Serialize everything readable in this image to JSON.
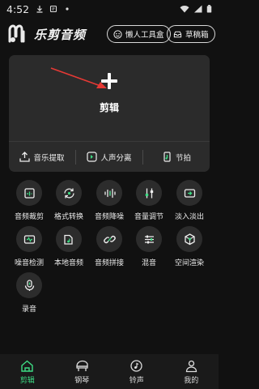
{
  "status_bar": {
    "time": "4:52"
  },
  "header": {
    "app_name": "乐剪音频",
    "toolbox_label": "懒人工具盒",
    "drafts_label": "草稿箱"
  },
  "edit_card": {
    "main_label": "剪辑",
    "tools": [
      {
        "label": "音乐提取",
        "icon": "upload-icon"
      },
      {
        "label": "人声分离",
        "icon": "voice-separate-icon"
      },
      {
        "label": "节拍",
        "icon": "beat-icon"
      }
    ]
  },
  "features": [
    {
      "label": "音频裁剪",
      "icon": "crop-icon"
    },
    {
      "label": "格式转换",
      "icon": "convert-icon"
    },
    {
      "label": "音频降噪",
      "icon": "denoise-icon"
    },
    {
      "label": "音量调节",
      "icon": "volume-slider-icon"
    },
    {
      "label": "淡入淡出",
      "icon": "fade-icon"
    },
    {
      "label": "噪音检测",
      "icon": "noise-detect-icon"
    },
    {
      "label": "本地音频",
      "icon": "folder-music-icon"
    },
    {
      "label": "音频拼接",
      "icon": "link-icon"
    },
    {
      "label": "混音",
      "icon": "mixer-icon"
    },
    {
      "label": "空间渲染",
      "icon": "cube-icon"
    },
    {
      "label": "录音",
      "icon": "microphone-icon"
    }
  ],
  "bottom_nav": {
    "items": [
      {
        "label": "剪辑",
        "icon": "home-icon",
        "active": true
      },
      {
        "label": "钢琴",
        "icon": "piano-icon",
        "active": false
      },
      {
        "label": "铃声",
        "icon": "ringtone-icon",
        "active": false
      },
      {
        "label": "我的",
        "icon": "user-icon",
        "active": false
      }
    ]
  },
  "colors": {
    "accent": "#3ddc84",
    "arrow": "#e53935",
    "card": "#2b2b2b",
    "background": "#111111"
  }
}
